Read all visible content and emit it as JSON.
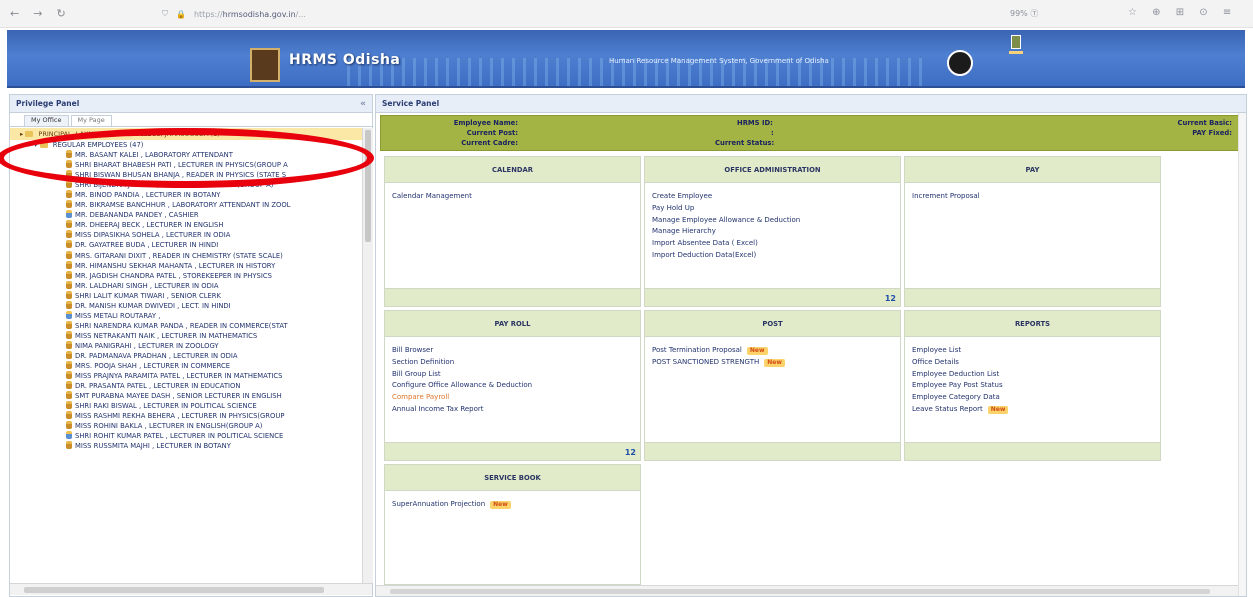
{
  "browser": {
    "url_prefix": "https://",
    "url_domain": "hrmsodisha.gov.in",
    "url_rest": "/...",
    "right_label": "99% Ⓣ",
    "right_icons": "☆ ⊕ ⊞ ⊙ ≡"
  },
  "banner": {
    "title": "HRMS Odisha",
    "subtitle": "Human Resource Management System, Government of Odisha"
  },
  "privilege_panel": {
    "title": "Privilege Panel",
    "collapse_icon": "«",
    "tabs": [
      "My Office",
      "My Page"
    ],
    "root": "PRINCIPAL, LAXMI NARAYAN COLLEGE, JHARSUGUDA (1)",
    "group": "REGULAR EMPLOYEES (47)",
    "employees": [
      "MR. BASANT KALEI , LABORATORY ATTENDANT",
      "SHRI BHARAT BHABESH PATI , LECTURER IN PHYSICS(GROUP A",
      "SHRI BISWAN BHUSAN BHANJA , READER IN PHYSICS (STATE S",
      "SHRI BIJENDRA JYOTISH , LECTURER IN PHYSICS(GROUP A)",
      "MR. BINOD PANDIA , LECTURER IN BOTANY",
      "MR. BIKRAMSE BANCHHUR , LABORATORY ATTENDANT IN ZOOL",
      "MR. DEBANANDA PANDEY , CASHIER",
      "MR. DHEERAJ BECK , LECTURER IN ENGLISH",
      "MISS DIPASIKHA SOHELA , LECTURER IN ODIA",
      "DR. GAYATREE BUDA , LECTURER IN HINDI",
      "MRS. GITARANI DIXIT , READER IN CHEMISTRY (STATE SCALE)",
      "MR. HIMANSHU SEKHAR MAHANTA , LECTURER IN HISTORY",
      "MR. JAGDISH CHANDRA PATEL , STOREKEEPER IN PHYSICS",
      "MR. LALDHARI SINGH , LECTURER IN ODIA",
      "SHRI LALIT KUMAR TIWARI , SENIOR CLERK",
      "DR. MANISH KUMAR DWIVEDI , LECT. IN HINDI",
      "MISS METALI ROUTARAY ,",
      "SHRI NARENDRA KUMAR PANDA , READER IN COMMERCE(STAT",
      "MISS NETRAKANTI NAIK , LECTURER IN MATHEMATICS",
      "NIMA PANIGRAHI , LECTURER IN ZOOLOGY",
      "DR. PADMANAVA PRADHAN , LECTURER IN ODIA",
      "MRS. POOJA SHAH , LECTURER IN COMMERCE",
      "MISS PRAJNYA PARAMITA PATEL , LECTURER IN MATHEMATICS",
      "DR. PRASANTA PATEL , LECTURER IN EDUCATION",
      "SMT PURABNA MAYEE DASH , SENIOR LECTURER IN ENGLISH",
      "SHRI RAKI BISWAL , LECTURER IN POLITICAL SCIENCE",
      "MISS RASHMI REKHA BEHERA , LECTURER IN PHYSICS(GROUP",
      "MISS ROHINI BAKLA , LECTURER IN ENGLISH(GROUP A)",
      "SHRI ROHIT KUMAR PATEL , LECTURER IN POLITICAL SCIENCE",
      "MISS RUSSMITA MAJHI , LECTURER IN BOTANY"
    ]
  },
  "service_panel": {
    "title": "Service Panel",
    "info": {
      "employee_name": "Employee Name:",
      "current_post": "Current Post:",
      "current_cadre": "Current Cadre:",
      "hrms_id": "HRMS ID:",
      "hrms_id_value": ":",
      "current_status": "Current Status:",
      "current_basic": "Current Basic:",
      "pay_fixed": "PAY Fixed:"
    },
    "cards": {
      "calendar": {
        "title": "CALENDAR",
        "items": [
          "Calendar Management"
        ]
      },
      "office_admin": {
        "title": "OFFICE ADMINISTRATION",
        "items": [
          "Create Employee",
          "Pay Hold Up",
          "Manage Employee Allowance & Deduction",
          "Manage Hierarchy",
          "Import Absentee Data ( Excel)",
          "Import Deduction Data(Excel)"
        ],
        "pager": "12"
      },
      "pay": {
        "title": "PAY",
        "items": [
          "Increment Proposal"
        ]
      },
      "payroll": {
        "title": "PAY ROLL",
        "items": [
          "Bill Browser",
          "Section Definition",
          "Bill Group List",
          "Configure Office Allowance & Deduction",
          "Compare Payroll",
          "Annual Income Tax Report"
        ],
        "pager": "12"
      },
      "post": {
        "title": "POST",
        "items": [
          "Post Termination Proposal",
          "POST SANCTIONED STRENGTH"
        ]
      },
      "reports": {
        "title": "REPORTS",
        "items": [
          "Employee List",
          "Office Details",
          "Employee Deduction List",
          "Employee Pay Post Status",
          "Employee Category Data",
          "Leave Status Report"
        ]
      },
      "service_book": {
        "title": "SERVICE BOOK",
        "items": [
          "SuperAnnuation Projection"
        ]
      }
    },
    "new_badge": "New"
  },
  "colors": {
    "info_bar": "#a3b344",
    "card_header": "#e1ebc9",
    "banner_blue": "#4e7fd0",
    "highlight_ellipse": "#e8000c",
    "selected_root": "#fbe7a6"
  }
}
